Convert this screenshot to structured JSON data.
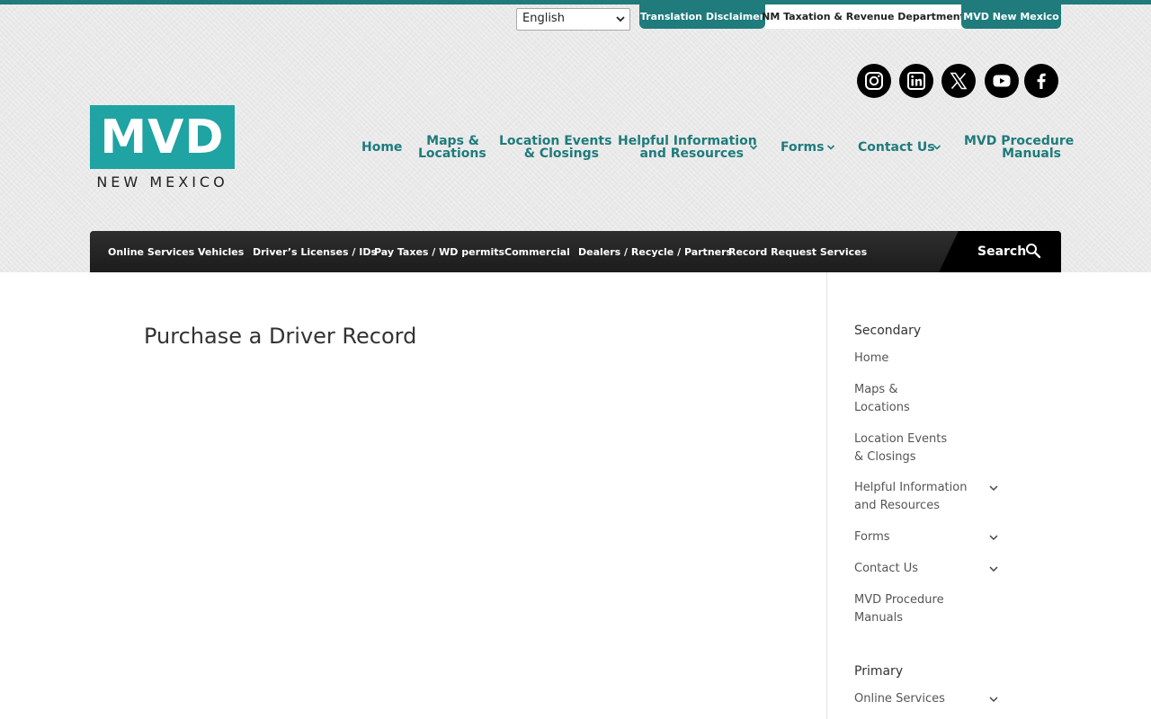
{
  "utility": {
    "language_value": "English",
    "translation_disclaimer": "Translation Disclaimer",
    "nm_taxation": "NM Taxation & Revenue Department",
    "mvd_new_mexico": "MVD New Mexico"
  },
  "social": [
    "instagram-icon",
    "linkedin-icon",
    "x-icon",
    "youtube-icon",
    "facebook-icon"
  ],
  "logo": {
    "mark": "MVD",
    "sub": "NEW MEXICO"
  },
  "main_nav": {
    "home": "Home",
    "maps_line1": "Maps &",
    "maps_line2": "Locations",
    "events_line1": "Location Events",
    "events_line2": "& Closings",
    "helpful_line1": "Helpful Information",
    "helpful_line2": "and Resources",
    "forms": "Forms",
    "contact": "Contact Us",
    "manuals_line1": "MVD Procedure",
    "manuals_line2": "Manuals"
  },
  "secondary_nav": {
    "online_services": "Online Services",
    "vehicles": "Vehicles",
    "licenses": "Driver’s Licenses / IDs",
    "pay_taxes": "Pay Taxes / WD permits",
    "commercial": "Commercial",
    "dealers": "Dealers / Recycle / Partners",
    "records": "Record Request Services",
    "search": "Search"
  },
  "content": {
    "title": "Purchase a Driver Record"
  },
  "sidebar": {
    "secondary_heading": "Secondary",
    "items": [
      {
        "line1": "Home",
        "line2": ""
      },
      {
        "line1": "Maps &",
        "line2": "Locations"
      },
      {
        "line1": "Location Events",
        "line2": "& Closings"
      },
      {
        "line1": "Helpful Information",
        "line2": "and Resources"
      },
      {
        "line1": "Forms",
        "line2": ""
      },
      {
        "line1": "Contact Us",
        "line2": ""
      },
      {
        "line1": "MVD Procedure",
        "line2": "Manuals"
      }
    ],
    "primary_heading": "Primary",
    "primary_items": [
      {
        "line1": "Online Services"
      }
    ]
  },
  "colors": {
    "teal": "#1f7b7c",
    "logo_teal": "#1fa3a3",
    "dark_bar": "#222222"
  }
}
